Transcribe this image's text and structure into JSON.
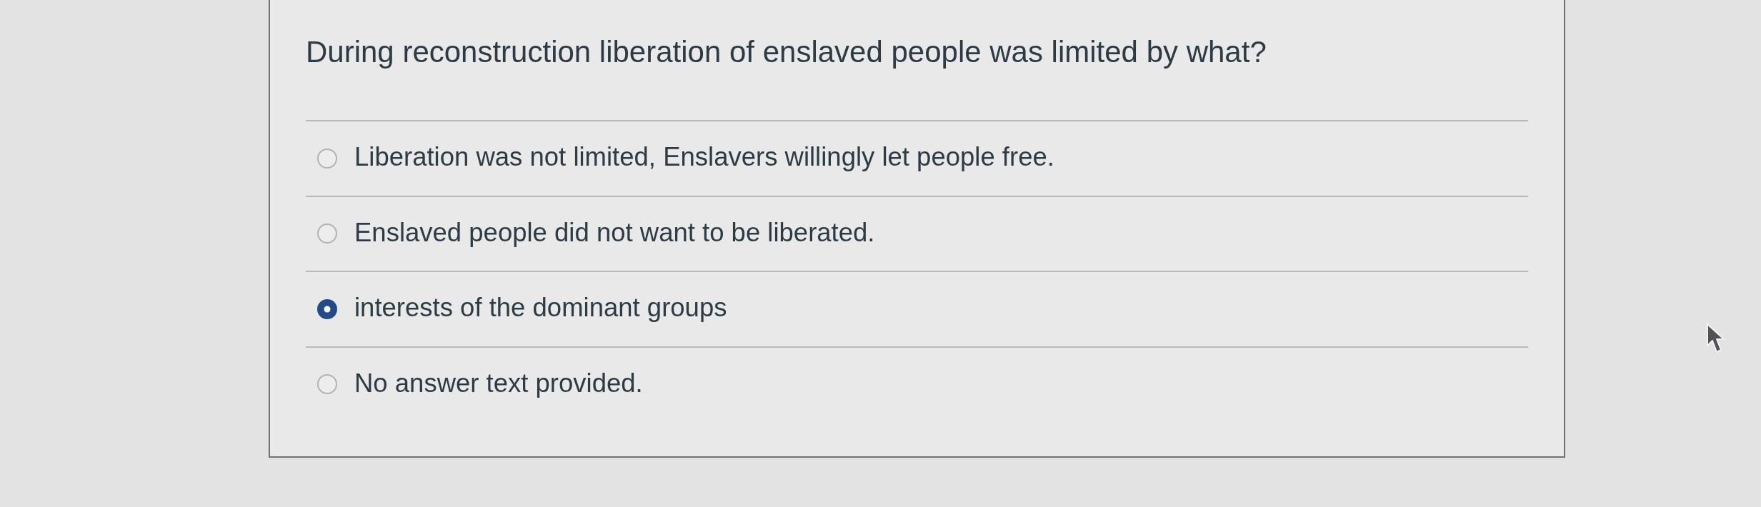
{
  "question": {
    "text": "During reconstruction liberation of enslaved people was limited by what?"
  },
  "options": [
    {
      "label": "Liberation was not limited, Enslavers willingly let people free.",
      "selected": false
    },
    {
      "label": "Enslaved people did not want to be liberated.",
      "selected": false
    },
    {
      "label": "interests of the dominant groups",
      "selected": true
    },
    {
      "label": "No answer text provided.",
      "selected": false
    }
  ]
}
